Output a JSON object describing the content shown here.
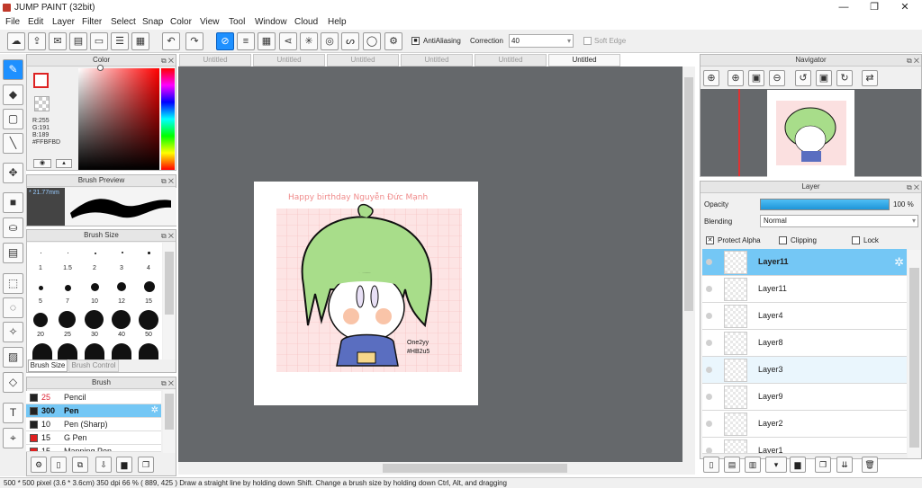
{
  "window": {
    "title": "JUMP PAINT (32bit)",
    "controls": [
      "—",
      "❐",
      "✕"
    ]
  },
  "menu": [
    "File",
    "Edit",
    "Layer",
    "Filter",
    "Select",
    "Snap",
    "Color",
    "View",
    "Tool",
    "Window",
    "Cloud",
    "Help"
  ],
  "toolbar": {
    "antialiasing_label": "AntiAliasing",
    "correction_label": "Correction",
    "correction_value": "40",
    "soft_edge_label": "Soft Edge"
  },
  "tabs": [
    "Untitled",
    "Untitled",
    "Untitled",
    "Untitled",
    "Untitled",
    "Untitled"
  ],
  "color_panel": {
    "title": "Color",
    "r": "R:255",
    "g": "G:191",
    "b": "B:189",
    "hex": "#FFBFBD",
    "fg_color": "#FFBFBD"
  },
  "brush_preview": {
    "title": "Brush Preview",
    "size": "* 21.77mm"
  },
  "brush_size": {
    "title": "Brush Size",
    "labels": [
      "1",
      "1.5",
      "2",
      "3",
      "4",
      "5",
      "7",
      "10",
      "12",
      "15",
      "20",
      "25",
      "30",
      "40",
      "50"
    ],
    "tab_active": "Brush Size",
    "tab_other": "Brush Control"
  },
  "brush": {
    "title": "Brush",
    "items": [
      {
        "size": "25",
        "name": "Pencil",
        "color": "#222222"
      },
      {
        "size": "300",
        "name": "Pen",
        "color": "#222222"
      },
      {
        "size": "10",
        "name": "Pen (Sharp)",
        "color": "#222222"
      },
      {
        "size": "15",
        "name": "G Pen",
        "color": "#e02020"
      },
      {
        "size": "15",
        "name": "Mapping Pen",
        "color": "#e02020"
      }
    ]
  },
  "navigator": {
    "title": "Navigator"
  },
  "layer_panel": {
    "title": "Layer",
    "opacity_label": "Opacity",
    "opacity_value": "100 %",
    "opacity": 1.0,
    "blending_label": "Blending",
    "blending_value": "Normal",
    "protect_alpha": "Protect Alpha",
    "clipping": "Clipping",
    "lock": "Lock",
    "layers": [
      "Layer11",
      "Layer11",
      "Layer4",
      "Layer8",
      "Layer3",
      "Layer9",
      "Layer2",
      "Layer1"
    ]
  },
  "artwork": {
    "text": "Happy birthday Nguyễn Đức Mạnh",
    "signature_1": "One2yy",
    "signature_2": "#HB2u5"
  },
  "status": "500 * 500 pixel   (3.6 * 3.6cm)   350 dpi   66 %   ( 889, 425 )   Draw a straight line by holding down Shift. Change a brush size by holding down Ctrl, Alt, and dragging",
  "colors": {
    "accent": "#1e90ff",
    "selected_row": "#74c7f5",
    "canvas_bg": "#65686b"
  }
}
